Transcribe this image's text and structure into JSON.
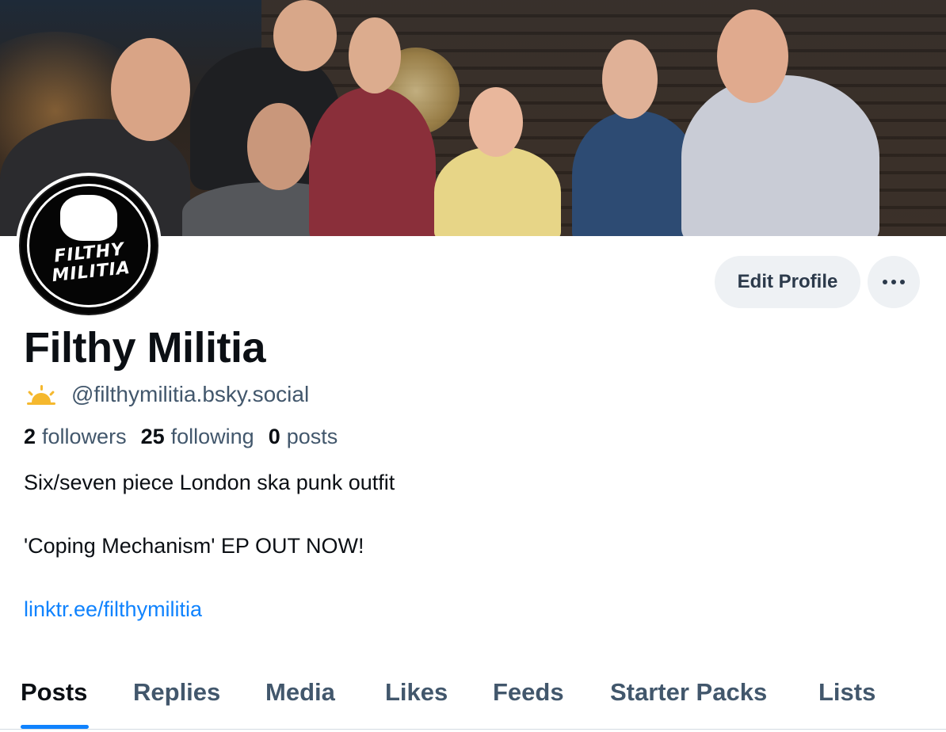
{
  "profile": {
    "display_name": "Filthy Militia",
    "handle": "@filthymilitia.bsky.social",
    "avatar_logo_line1": "FILTHY",
    "avatar_logo_line2": "MILITIA"
  },
  "stats": {
    "followers_count": "2",
    "followers_label": "followers",
    "following_count": "25",
    "following_label": "following",
    "posts_count": "0",
    "posts_label": "posts"
  },
  "bio": {
    "line1": "Six/seven piece London ska punk outfit",
    "line2": "'Coping Mechanism' EP OUT NOW!",
    "link": "linktr.ee/filthymilitia"
  },
  "actions": {
    "edit_label": "Edit Profile",
    "more_label": "•••"
  },
  "tabs": [
    {
      "label": "Posts",
      "active": true
    },
    {
      "label": "Replies",
      "active": false
    },
    {
      "label": "Media",
      "active": false
    },
    {
      "label": "Likes",
      "active": false
    },
    {
      "label": "Feeds",
      "active": false
    },
    {
      "label": "Starter Packs",
      "active": false
    },
    {
      "label": "Lists",
      "active": false
    }
  ],
  "colors": {
    "accent": "#1083fe",
    "text_primary": "#0b0f14",
    "text_secondary": "#42576c",
    "button_bg": "#eef1f4",
    "sun_icon": "#f5b82e"
  },
  "icons": {
    "handle_icon": "sun-icon",
    "more_icon": "ellipsis-icon"
  }
}
